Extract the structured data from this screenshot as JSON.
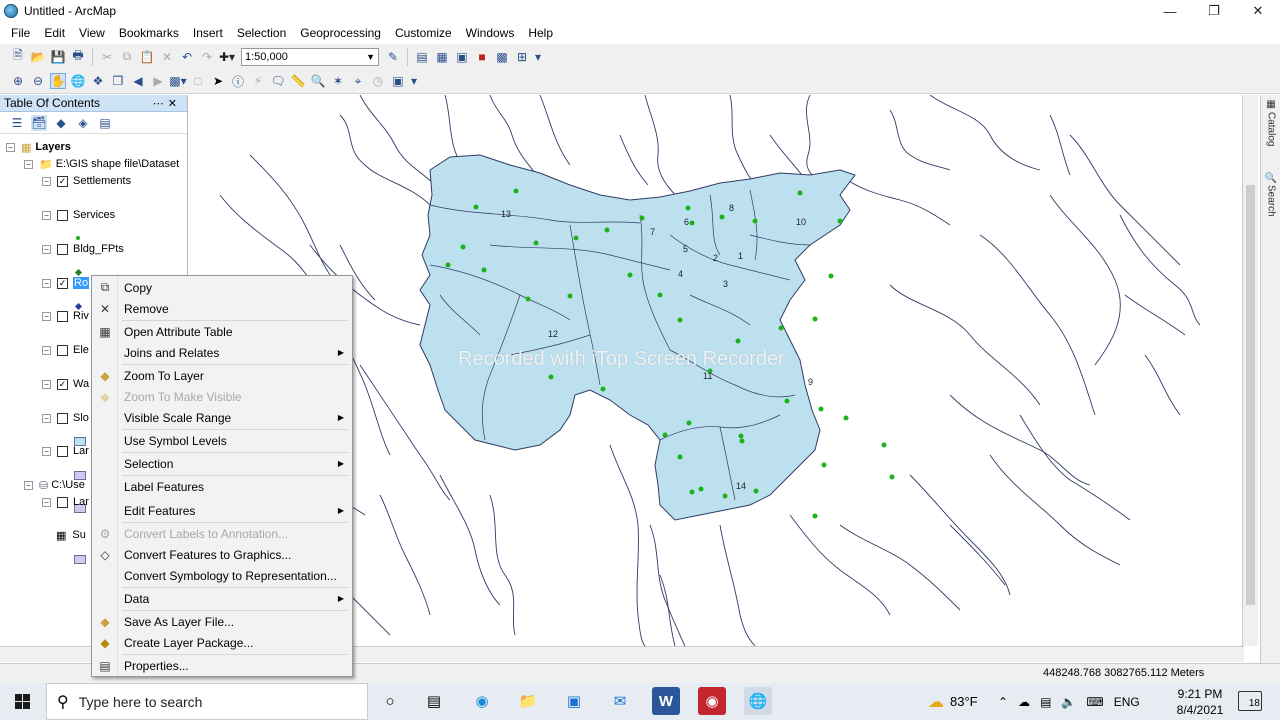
{
  "window": {
    "title": "Untitled - ArcMap"
  },
  "menu": [
    "File",
    "Edit",
    "View",
    "Bookmarks",
    "Insert",
    "Selection",
    "Geoprocessing",
    "Customize",
    "Windows",
    "Help"
  ],
  "toolbar": {
    "scale": "1:50,000"
  },
  "toc": {
    "title": "Table Of Contents",
    "root": "Layers",
    "group1": "E:\\GIS shape file\\Dataset",
    "layers": [
      {
        "name": "Settlements",
        "checked": true
      },
      {
        "name": "Services",
        "checked": false
      },
      {
        "name": "Bldg_FPts",
        "checked": false
      },
      {
        "name": "Ro",
        "checked": true
      },
      {
        "name": "Riv",
        "checked": false
      },
      {
        "name": "Ele",
        "checked": false
      },
      {
        "name": "Wa",
        "checked": true
      },
      {
        "name": "Slo",
        "checked": false
      },
      {
        "name": "Lar",
        "checked": false
      }
    ],
    "group2": "C:\\Use",
    "group2_layers": [
      {
        "name": "Lar",
        "checked": false
      },
      {
        "name": "Su"
      }
    ]
  },
  "context_menu": {
    "items": [
      {
        "label": "Copy",
        "icon": "copy-icon"
      },
      {
        "label": "Remove",
        "icon": "remove-icon"
      },
      {
        "label": "Open Attribute Table",
        "icon": "table-icon"
      },
      {
        "label": "Joins and Relates",
        "submenu": true
      },
      {
        "label": "Zoom To Layer",
        "icon": "zoom-layer-icon"
      },
      {
        "label": "Zoom To Make Visible",
        "disabled": true
      },
      {
        "label": "Visible Scale Range",
        "submenu": true
      },
      {
        "label": "Use Symbol Levels"
      },
      {
        "label": "Selection",
        "submenu": true
      },
      {
        "label": "Label Features"
      },
      {
        "label": "Edit Features",
        "submenu": true
      },
      {
        "label": "Convert Labels to Annotation...",
        "disabled": true
      },
      {
        "label": "Convert Features to Graphics..."
      },
      {
        "label": "Convert Symbology to Representation..."
      },
      {
        "label": "Data",
        "submenu": true
      },
      {
        "label": "Save As Layer File..."
      },
      {
        "label": "Create Layer Package..."
      },
      {
        "label": "Properties..."
      }
    ]
  },
  "map": {
    "watermark": "Recorded with iTop Screen Recorder",
    "labels": [
      "13",
      "7",
      "6",
      "8",
      "10",
      "5",
      "2",
      "1",
      "4",
      "3",
      "12",
      "11",
      "9",
      "14"
    ],
    "fill_color": "#bde0ef",
    "point_color": "#1db11d"
  },
  "status": {
    "coordinates": "448248.768  3082765.112 Meters"
  },
  "side_tabs": [
    "Catalog",
    "Search"
  ],
  "taskbar": {
    "search_placeholder": "Type here to search",
    "temperature": "83°F",
    "language": "ENG",
    "time": "9:21 PM",
    "date": "8/4/2021",
    "notifications": "18"
  }
}
